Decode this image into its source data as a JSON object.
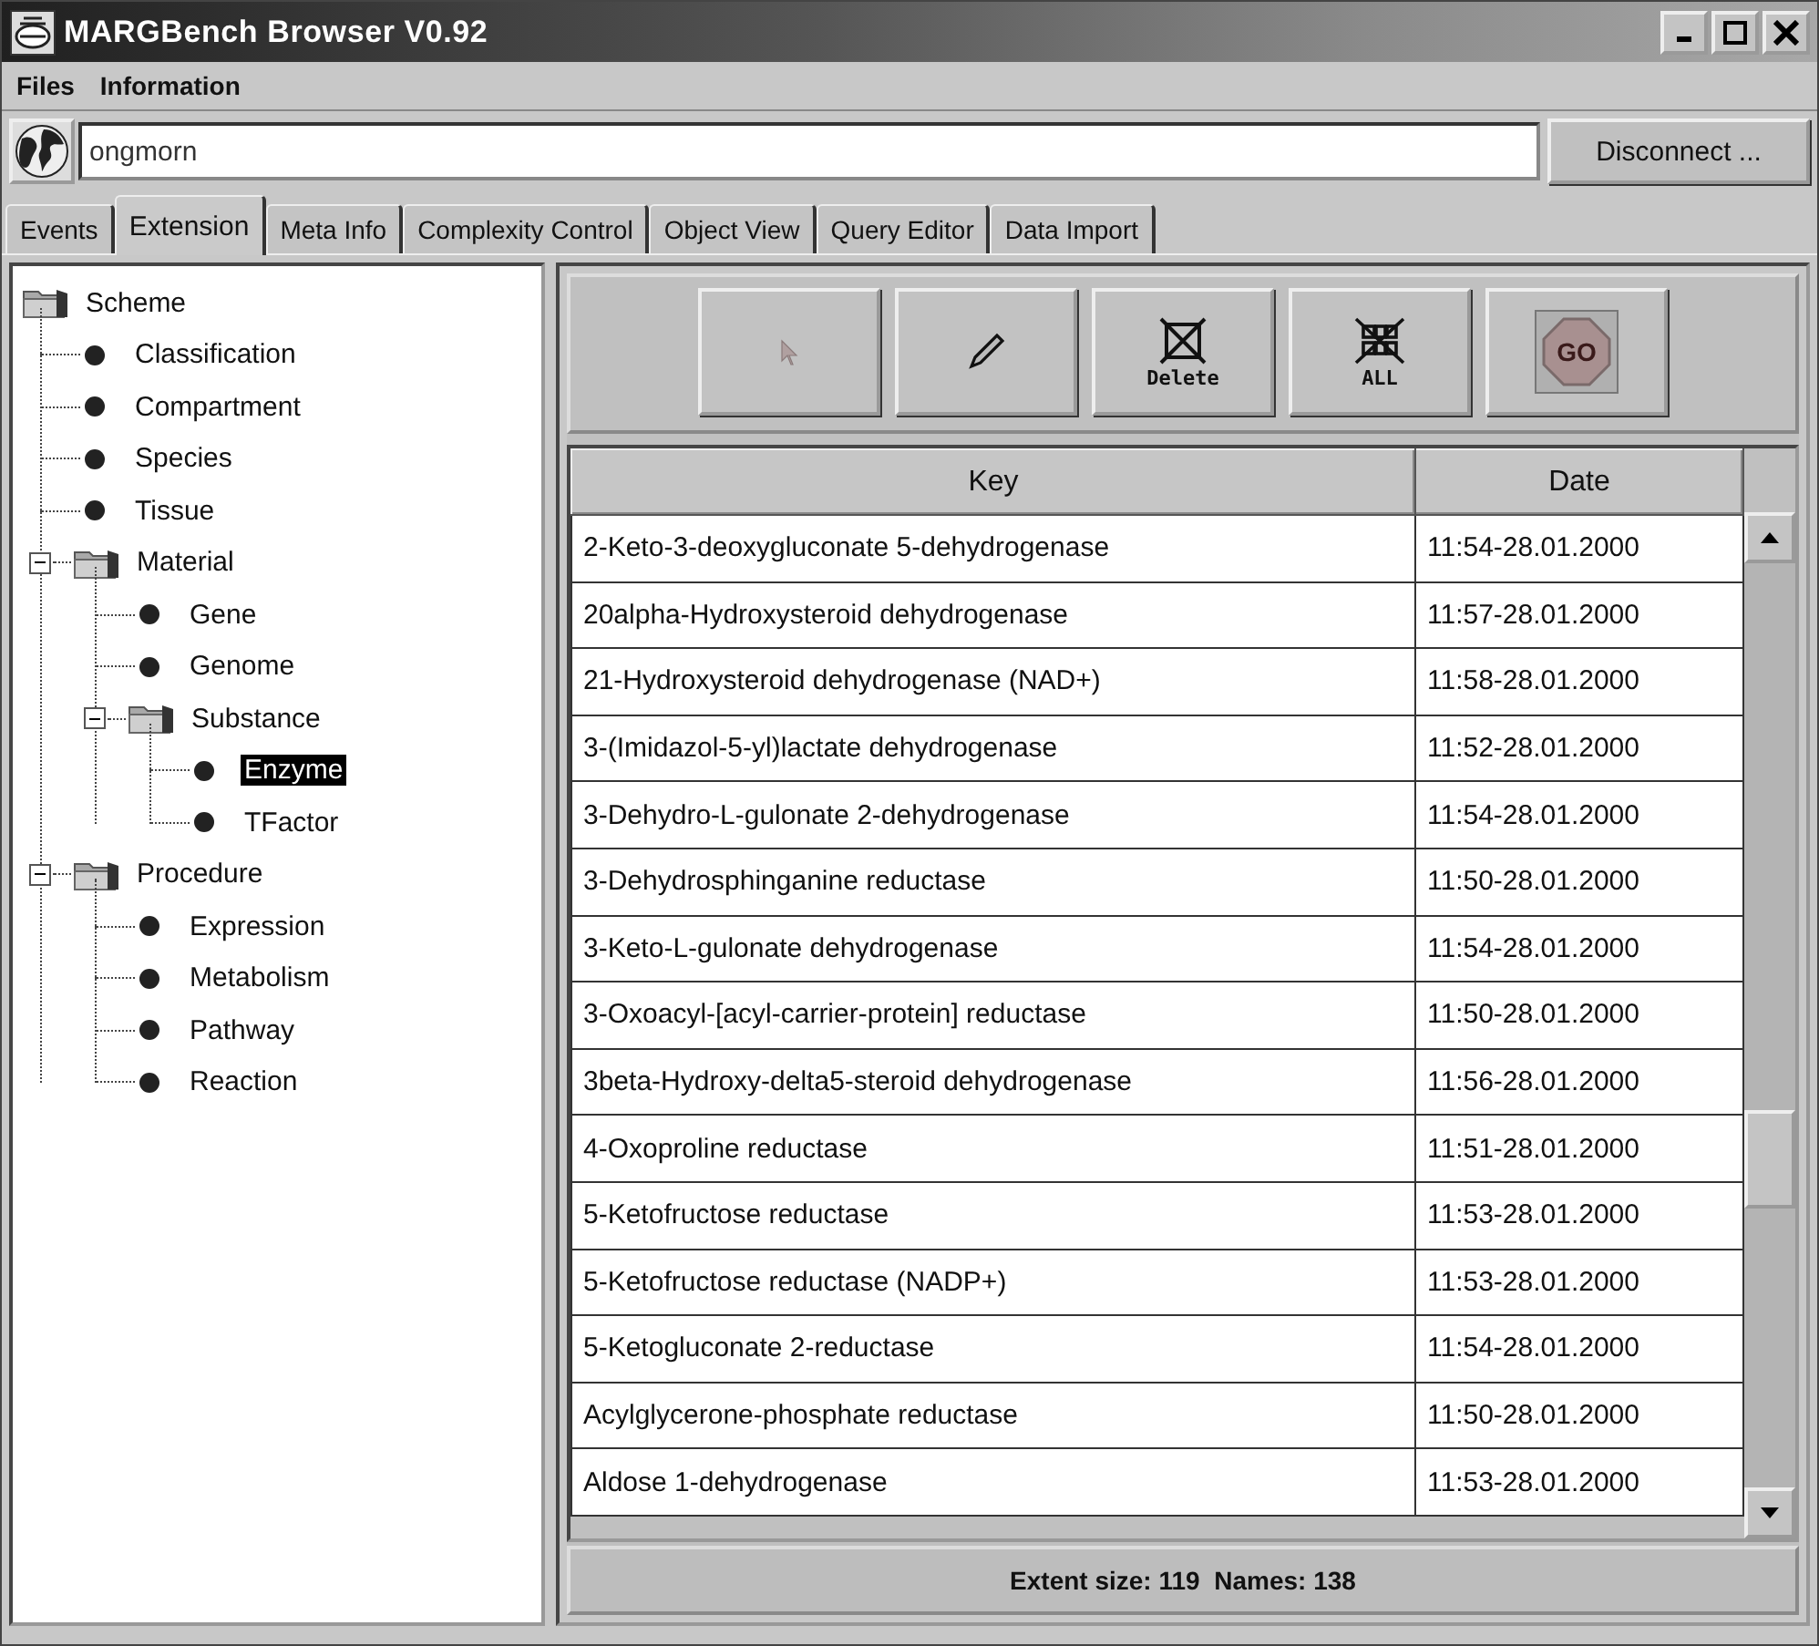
{
  "window": {
    "title": "MARGBench Browser V0.92"
  },
  "menu": [
    "Files",
    "Information"
  ],
  "connection": {
    "value": "ongmorn",
    "button": "Disconnect ..."
  },
  "tabs": [
    {
      "label": "Events",
      "selected": false
    },
    {
      "label": "Extension",
      "selected": true
    },
    {
      "label": "Meta Info",
      "selected": false
    },
    {
      "label": "Complexity Control",
      "selected": false
    },
    {
      "label": "Object View",
      "selected": false
    },
    {
      "label": "Query Editor",
      "selected": false
    },
    {
      "label": "Data Import",
      "selected": false
    }
  ],
  "tree": [
    {
      "label": "Scheme",
      "kind": "root",
      "selected": false,
      "children": [
        {
          "label": "Classification",
          "kind": "leaf",
          "selected": false
        },
        {
          "label": "Compartment",
          "kind": "leaf",
          "selected": false
        },
        {
          "label": "Species",
          "kind": "leaf",
          "selected": false
        },
        {
          "label": "Tissue",
          "kind": "leaf",
          "selected": false
        },
        {
          "label": "Material",
          "kind": "folder",
          "expanded": true,
          "selected": false,
          "children": [
            {
              "label": "Gene",
              "kind": "leaf",
              "selected": false
            },
            {
              "label": "Genome",
              "kind": "leaf",
              "selected": false
            },
            {
              "label": "Substance",
              "kind": "folder",
              "expanded": true,
              "selected": false,
              "children": [
                {
                  "label": "Enzyme",
                  "kind": "leaf",
                  "selected": true
                },
                {
                  "label": "TFactor",
                  "kind": "leaf",
                  "selected": false
                }
              ]
            }
          ]
        },
        {
          "label": "Procedure",
          "kind": "folder",
          "expanded": true,
          "selected": false,
          "children": [
            {
              "label": "Expression",
              "kind": "leaf",
              "selected": false
            },
            {
              "label": "Metabolism",
              "kind": "leaf",
              "selected": false
            },
            {
              "label": "Pathway",
              "kind": "leaf",
              "selected": false
            },
            {
              "label": "Reaction",
              "kind": "leaf",
              "selected": false
            }
          ]
        }
      ]
    }
  ],
  "toolbar": [
    {
      "kind": "pointer"
    },
    {
      "kind": "pencil"
    },
    {
      "kind": "delete",
      "label": "Delete"
    },
    {
      "kind": "all",
      "label": "ALL"
    },
    {
      "kind": "go",
      "label": "GO"
    }
  ],
  "table": {
    "columns": [
      "Key",
      "Date"
    ],
    "rows": [
      [
        "2-Keto-3-deoxygluconate 5-dehydrogenase",
        "11:54-28.01.2000"
      ],
      [
        "20alpha-Hydroxysteroid dehydrogenase",
        "11:57-28.01.2000"
      ],
      [
        "21-Hydroxysteroid dehydrogenase (NAD+)",
        "11:58-28.01.2000"
      ],
      [
        "3-(Imidazol-5-yl)lactate dehydrogenase",
        "11:52-28.01.2000"
      ],
      [
        "3-Dehydro-L-gulonate 2-dehydrogenase",
        "11:54-28.01.2000"
      ],
      [
        "3-Dehydrosphinganine reductase",
        "11:50-28.01.2000"
      ],
      [
        "3-Keto-L-gulonate dehydrogenase",
        "11:54-28.01.2000"
      ],
      [
        "3-Oxoacyl-[acyl-carrier-protein] reductase",
        "11:50-28.01.2000"
      ],
      [
        "3beta-Hydroxy-delta5-steroid dehydrogenase",
        "11:56-28.01.2000"
      ],
      [
        "4-Oxoproline reductase",
        "11:51-28.01.2000"
      ],
      [
        "5-Ketofructose reductase",
        "11:53-28.01.2000"
      ],
      [
        "5-Ketofructose reductase (NADP+)",
        "11:53-28.01.2000"
      ],
      [
        "5-Ketogluconate 2-reductase",
        "11:54-28.01.2000"
      ],
      [
        "Acylglycerone-phosphate reductase",
        "11:50-28.01.2000"
      ],
      [
        "Aldose 1-dehydrogenase",
        "11:53-28.01.2000"
      ]
    ]
  },
  "status_bar": "Extent size: 119  Names: 138"
}
